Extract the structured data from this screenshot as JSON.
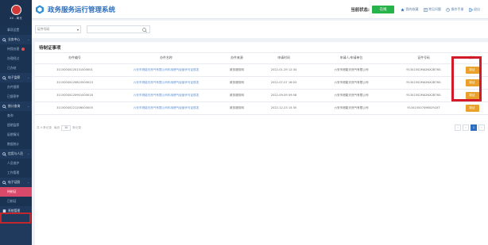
{
  "sidebar": {
    "user_name": "XX - 局长",
    "items": [
      {
        "label": "事项设置",
        "type": "sub"
      },
      {
        "label": "业务中心",
        "type": "group",
        "icon": "search-icon",
        "arrow": "chevron-down-icon"
      },
      {
        "label": "待我处理",
        "type": "sub",
        "badge": true
      },
      {
        "label": "办理经过",
        "type": "sub"
      },
      {
        "label": "已办结",
        "type": "sub"
      },
      {
        "label": "电子监察",
        "type": "group",
        "icon": "search-icon",
        "arrow": "chevron-down-icon"
      },
      {
        "label": "办件督察",
        "type": "sub"
      },
      {
        "label": "已督察件",
        "type": "sub"
      },
      {
        "label": "统计查询",
        "type": "group",
        "icon": "search-icon",
        "arrow": "chevron-down-icon"
      },
      {
        "label": "查询",
        "type": "sub"
      },
      {
        "label": "超期监察",
        "type": "sub"
      },
      {
        "label": "延期情况",
        "type": "sub"
      },
      {
        "label": "数据统计",
        "type": "sub"
      },
      {
        "label": "信用与人员",
        "type": "group",
        "icon": "search-icon",
        "arrow": "chevron-down-icon"
      },
      {
        "label": "人员维护",
        "type": "sub"
      },
      {
        "label": "工作管理",
        "type": "sub"
      },
      {
        "label": "电子证照",
        "type": "group",
        "icon": "search-icon",
        "arrow": "chevron-down-icon"
      },
      {
        "label": "待制证",
        "type": "sub",
        "active": true
      },
      {
        "label": "已制证",
        "type": "sub"
      },
      {
        "label": "系统管理",
        "type": "group",
        "icon": "doc-icon"
      }
    ]
  },
  "header": {
    "title": "政务服务运行管理系统",
    "status_label": "当前状态:",
    "status_button": "在线",
    "links": [
      {
        "label": "我的收藏",
        "icon": "star-icon"
      },
      {
        "label": "常见问题",
        "icon": "doc-icon"
      },
      {
        "label": "操作手册",
        "icon": "clock-icon"
      },
      {
        "label": "退出",
        "icon": "exit-icon"
      }
    ]
  },
  "filter": {
    "select_value": "证件号码",
    "search_placeholder": ""
  },
  "panel": {
    "title": "待制证事项",
    "columns": [
      "办件编号",
      "办件名称",
      "办件来源",
      "申请时间",
      "申请人/申请单位",
      "证件号码",
      "操作"
    ],
    "rows": [
      {
        "id": "31150045220131000001",
        "name": "六安市燃能天然气有限公司车用燃气经营许可证核发",
        "source": "政务服务网",
        "time": "2022-01-29 12:34",
        "applicant": "六安市燃能天然气有限公司",
        "cert": "91341502MA2NX2B76G",
        "action": "制证"
      },
      {
        "id": "31150045220815000023",
        "name": "六安市燃能天然气有限公司车用燃气经营许可证核发",
        "source": "政务服务网",
        "time": "2022-07-07 16:03",
        "applicant": "六安市燃能天然气有限公司",
        "cert": "91341502MA2NX2B76G",
        "action": "制证"
      },
      {
        "id": "31150045220901000018",
        "name": "六安市燃能天然气有限公司车用燃气经营许可证核发",
        "source": "政务服务网",
        "time": "2022-09-09 09:58",
        "applicant": "六安市燃能天然气有限公司",
        "cert": "91341502MA2NX2B76G",
        "action": "制证"
      },
      {
        "id": "31150045221206000005",
        "name": "六安市燃能天然气有限公司车用燃气经营许可证核发",
        "source": "政务服务网",
        "time": "2022-12-23 15:35",
        "applicant": "六安市燃能天然气有限公司",
        "cert": "9134150074960292XT",
        "action": "制证"
      }
    ]
  },
  "pager": {
    "prefix": "共 4 条记录",
    "mid_prefix": "每页",
    "page_size": "10",
    "mid_suffix": "条记录",
    "prev": "‹",
    "page": "1",
    "next": "›",
    "last": "»"
  },
  "colors": {
    "sidebar_bg": "#1f3a5c",
    "title_blue": "#2d6fbf",
    "status_green": "#27b24a",
    "action_orange": "#e9a12b",
    "highlight_red": "#d21a28",
    "active_item": "#d94a6a"
  }
}
